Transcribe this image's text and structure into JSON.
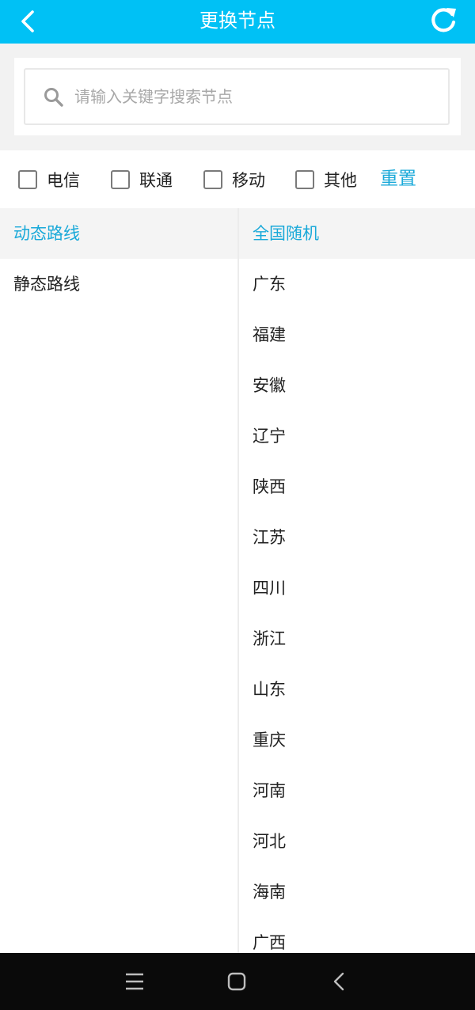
{
  "header": {
    "title": "更换节点",
    "back_icon": "chevron-left-icon",
    "refresh_icon": "refresh-icon"
  },
  "search": {
    "placeholder": "请输入关键字搜索节点",
    "value": "",
    "icon": "search-icon"
  },
  "filters": {
    "options": [
      {
        "label": "电信",
        "checked": false
      },
      {
        "label": "联通",
        "checked": false
      },
      {
        "label": "移动",
        "checked": false
      },
      {
        "label": "其他",
        "checked": false
      }
    ],
    "reset_label": "重置"
  },
  "route_types": [
    {
      "label": "动态路线",
      "selected": true
    },
    {
      "label": "静态路线",
      "selected": false
    }
  ],
  "regions": [
    {
      "label": "全国随机",
      "selected": true
    },
    {
      "label": "广东",
      "selected": false
    },
    {
      "label": "福建",
      "selected": false
    },
    {
      "label": "安徽",
      "selected": false
    },
    {
      "label": "辽宁",
      "selected": false
    },
    {
      "label": "陕西",
      "selected": false
    },
    {
      "label": "江苏",
      "selected": false
    },
    {
      "label": "四川",
      "selected": false
    },
    {
      "label": "浙江",
      "selected": false
    },
    {
      "label": "山东",
      "selected": false
    },
    {
      "label": "重庆",
      "selected": false
    },
    {
      "label": "河南",
      "selected": false
    },
    {
      "label": "河北",
      "selected": false
    },
    {
      "label": "海南",
      "selected": false
    },
    {
      "label": "广西",
      "selected": false
    }
  ],
  "navbar": {
    "menu_icon": "menu-icon",
    "home_icon": "home-square-icon",
    "back_icon": "back-triangle-icon"
  },
  "colors": {
    "accent": "#00c1f5",
    "accent_text": "#1aa9d9",
    "navbar": "#0a0a0a"
  }
}
